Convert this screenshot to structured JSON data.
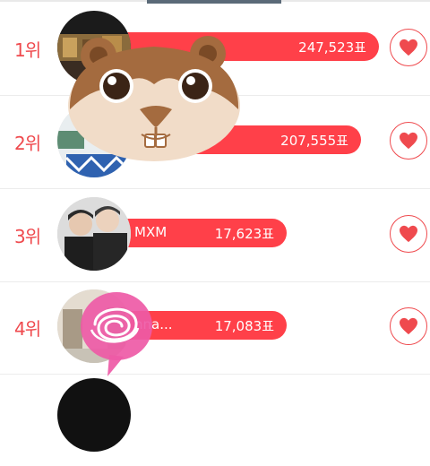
{
  "ranking": [
    {
      "rank": "1위",
      "name": "",
      "votes": "247,523표"
    },
    {
      "rank": "2위",
      "name": "",
      "votes": "207,555표"
    },
    {
      "rank": "3위",
      "name": "MXM",
      "votes": "17,623표"
    },
    {
      "rank": "4위",
      "name": "nna...",
      "votes": "17,083표"
    }
  ],
  "colors": {
    "accent": "#ff4049",
    "rank_text": "#ef4a4e"
  },
  "icons": {
    "vote": "heart-icon"
  }
}
